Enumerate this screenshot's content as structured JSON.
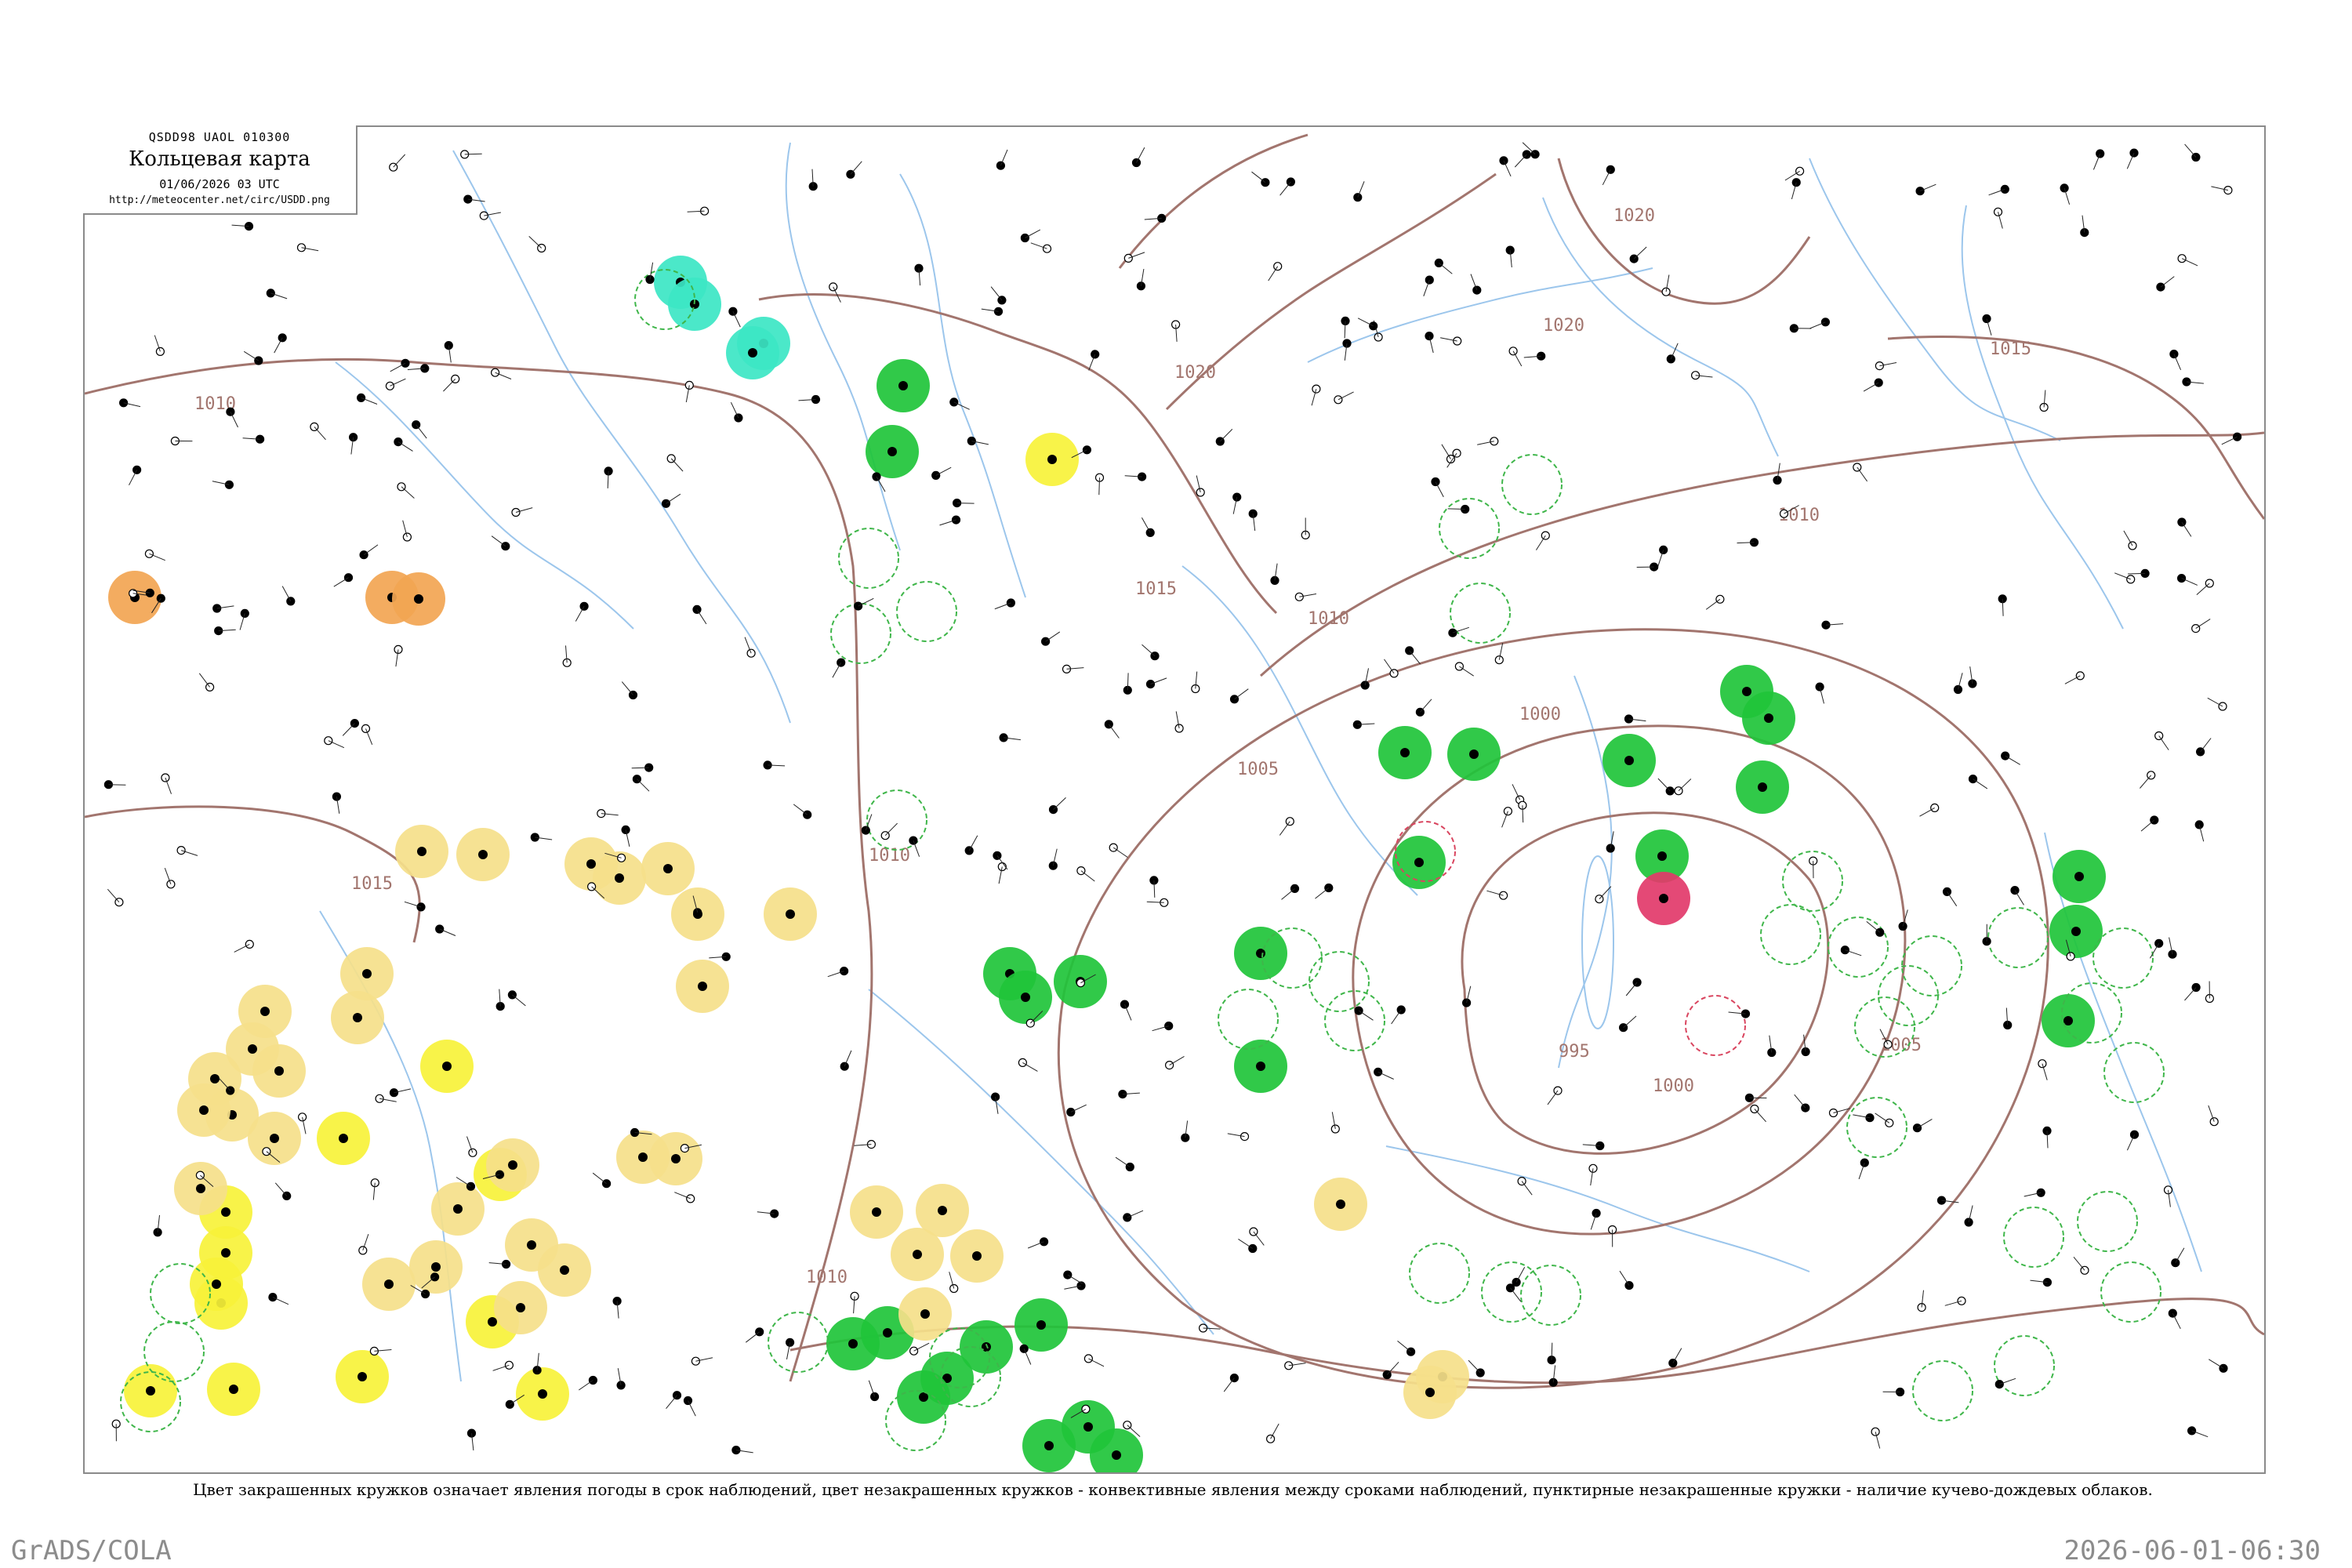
{
  "header": {
    "code": "QSDD98  UAOL  010300",
    "title": "Кольцевая карта",
    "date": "01/06/2026 03 UTC",
    "url": "http://meteocenter.net/circ/USDD.png"
  },
  "isobar_labels": [
    "1000",
    "1005",
    "1010",
    "1015",
    "1020",
    "995"
  ],
  "caption": "Цвет закрашенных кружков означает явления погоды в срок наблюдений, цвет незакрашенных кружков - конвективные явления между сроками наблюдений, пунктирные незакрашенные кружки - наличие кучево-дождевых облаков.",
  "footer": {
    "left": "GrADS/COLA",
    "right": "2026-06-01-06:30"
  },
  "colors": {
    "isobar": "#a2756e",
    "river": "#9cc6ec",
    "rain": "#1fc43a",
    "showers": "#f7f23a",
    "fog_haze": "#f5df8a",
    "smoke_dust": "#f2a553",
    "snow": "#3ce6c4",
    "thunder": "#e23a6a",
    "cb_outline": "#3fb64a",
    "thunder_outline": "#d9455f"
  },
  "legend_classes": [
    "rain",
    "showers",
    "fog_haze",
    "smoke_dust",
    "snow",
    "thunder"
  ]
}
